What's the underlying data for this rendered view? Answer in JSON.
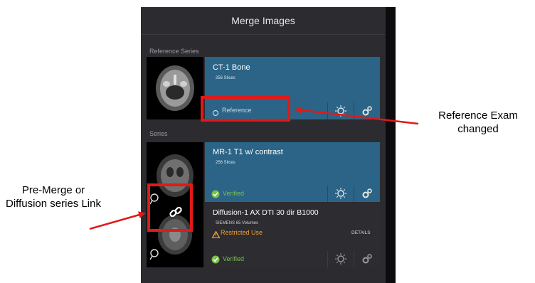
{
  "panel": {
    "title": "Merge Images",
    "reference_section_label": "Reference Series",
    "series_section_label": "Series"
  },
  "reference_card": {
    "title": "CT-1 Bone",
    "subtitle": "256 Slices",
    "status_label": "Reference"
  },
  "series_cards": [
    {
      "title": "MR-1 T1 w/ contrast",
      "subtitle": "256 Slices",
      "status_label": "Verified"
    },
    {
      "title": "Diffusion-1 AX DTI 30 dir B1000",
      "subtitle": "SIEMENS 65 Volumes",
      "warning_label": "Restricted Use",
      "details_label": "DETAILS",
      "status_label": "Verified"
    }
  ],
  "annotations": {
    "reference_changed": "Reference Exam changed",
    "link_note": "Pre-Merge or Diffusion series Link"
  },
  "colors": {
    "panel_bg": "#2b2b30",
    "card_blue": "#2b6486",
    "verified_green": "#7cc04a",
    "warning_orange": "#f0a030",
    "annotation_red": "#e01919"
  },
  "icons": [
    "brightness-icon",
    "gear-icon",
    "link-icon",
    "check-circle-icon",
    "warning-icon",
    "reference-dot-icon",
    "pin-icon"
  ]
}
